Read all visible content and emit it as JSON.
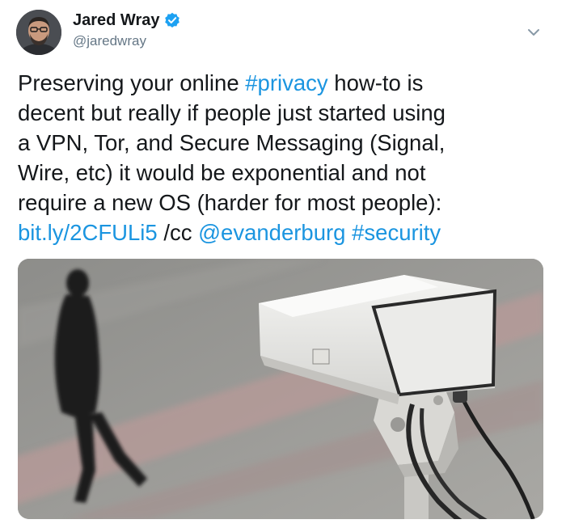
{
  "author": {
    "name": "Jared Wray",
    "handle": "@jaredwray",
    "verified": true,
    "avatar_icon": "person-avatar"
  },
  "menu_icon": "chevron-down-icon",
  "tweet": {
    "lines": [
      [
        {
          "text": "Preserving your online ",
          "type": "text"
        },
        {
          "text": "#privacy",
          "type": "hashtag"
        },
        {
          "text": " how-to is",
          "type": "text"
        }
      ],
      [
        {
          "text": "decent but really if people just started using",
          "type": "text"
        }
      ],
      [
        {
          "text": "a VPN, Tor, and Secure Messaging (Signal,",
          "type": "text"
        }
      ],
      [
        {
          "text": "Wire, etc) it would be exponential and not",
          "type": "text"
        }
      ],
      [
        {
          "text": "require a new OS (harder for most people):",
          "type": "text"
        }
      ],
      [
        {
          "text": "bit.ly/2CFULi5",
          "type": "link"
        },
        {
          "text": " /cc ",
          "type": "text"
        },
        {
          "text": "@evanderburg",
          "type": "mention"
        },
        {
          "text": " ",
          "type": "text"
        },
        {
          "text": "#security",
          "type": "hashtag"
        }
      ]
    ]
  },
  "media": {
    "icon": "surveillance-camera-photo"
  },
  "colors": {
    "link": "#1b95e0",
    "text": "#14171a",
    "secondary": "#657786",
    "verified": "#1da1f2"
  }
}
